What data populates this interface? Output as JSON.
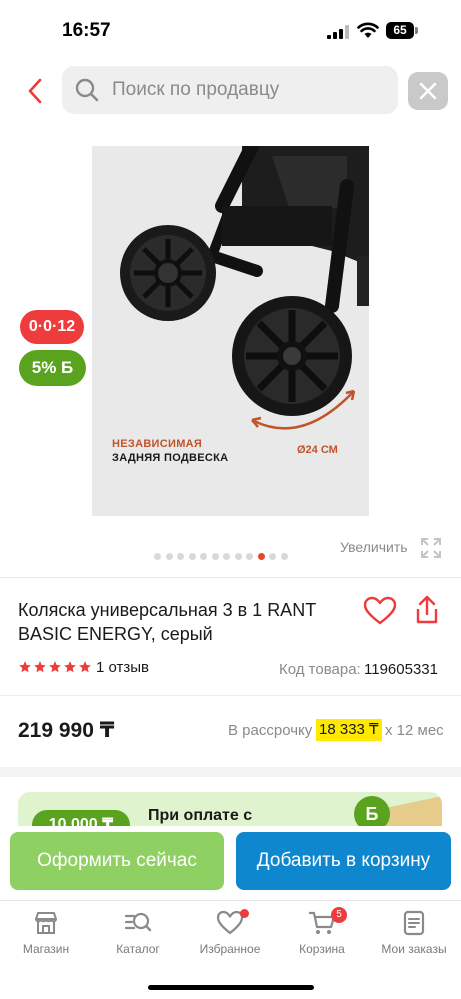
{
  "status_bar": {
    "time": "16:57",
    "battery": "65"
  },
  "search": {
    "placeholder": "Поиск по продавцу"
  },
  "product": {
    "image_caption_line1": "НЕЗАВИСИМАЯ",
    "image_caption_line2": "ЗАДНЯЯ ПОДВЕСКА",
    "image_size_label": "Ø24 СМ",
    "badge_installment": "0·0·12",
    "badge_bonus": "5% Б",
    "carousel": {
      "total": 12,
      "active_index": 9
    },
    "enlarge_label": "Увеличить",
    "title": "Коляска универсальная 3 в 1 RANT BASIC ENERGY, серый",
    "rating": 5,
    "reviews": "1 отзыв",
    "code_label": "Код товара:",
    "code_value": "119605331",
    "price": "219 990 ₸",
    "installment_label": "В рассрочку",
    "installment_value": "18 333 ₸",
    "installment_term": "х 12 мес"
  },
  "promo": {
    "pill": "10 000 ₸",
    "text": "При оплате с",
    "coin": "Б"
  },
  "actions": {
    "buy_now": "Оформить сейчас",
    "add_to_cart": "Добавить в корзину"
  },
  "nav": {
    "items": [
      {
        "label": "Магазин",
        "icon": "store-icon"
      },
      {
        "label": "Каталог",
        "icon": "catalog-search-icon"
      },
      {
        "label": "Избранное",
        "icon": "heart-icon"
      },
      {
        "label": "Корзина",
        "icon": "cart-icon",
        "badge": "5"
      },
      {
        "label": "Мои заказы",
        "icon": "orders-icon"
      }
    ]
  },
  "colors": {
    "accent_red": "#ee3b3b",
    "bonus_green": "#5aa31e",
    "buy_button": "#8fd062",
    "cart_button": "#0e87cf",
    "installment_highlight": "#ffe900"
  }
}
